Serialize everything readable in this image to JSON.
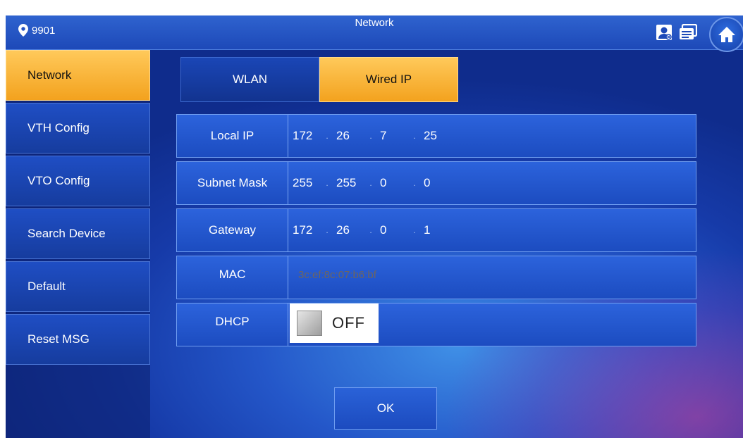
{
  "header": {
    "device_id": "9901",
    "title": "Network",
    "icons": [
      "location-pin-icon",
      "contact-card-icon",
      "message-icon",
      "home-icon"
    ]
  },
  "sidebar": {
    "items": [
      {
        "label": "Network",
        "active": true
      },
      {
        "label": "VTH Config",
        "active": false
      },
      {
        "label": "VTO Config",
        "active": false
      },
      {
        "label": "Search Device",
        "active": false
      },
      {
        "label": "Default",
        "active": false
      },
      {
        "label": "Reset MSG",
        "active": false
      }
    ]
  },
  "tabs": [
    {
      "label": "WLAN",
      "selected": false
    },
    {
      "label": "Wired IP",
      "selected": true
    }
  ],
  "form": {
    "local_ip": {
      "label": "Local IP",
      "octets": [
        "172",
        "26",
        "7",
        "25"
      ]
    },
    "subnet_mask": {
      "label": "Subnet Mask",
      "octets": [
        "255",
        "255",
        "0",
        "0"
      ]
    },
    "gateway": {
      "label": "Gateway",
      "octets": [
        "172",
        "26",
        "0",
        "1"
      ]
    },
    "mac": {
      "label": "MAC",
      "value": "3c:ef:8c:07:b6:bf"
    },
    "dhcp": {
      "label": "DHCP",
      "state": "OFF"
    }
  },
  "ok_label": "OK",
  "colors": {
    "accent": "#f5a623",
    "panel": "#1f4ec4",
    "background": "#163aa8"
  }
}
